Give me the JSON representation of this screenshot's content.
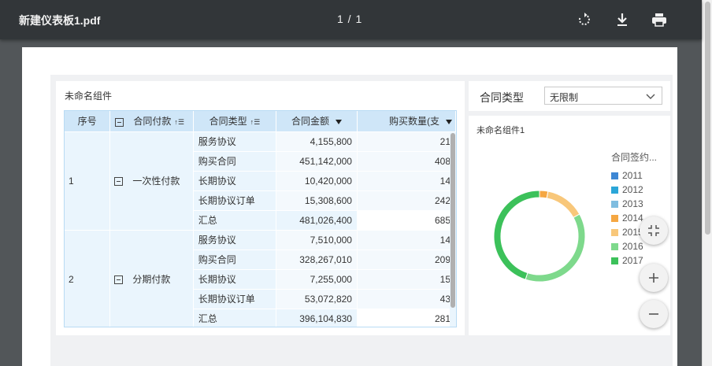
{
  "toolbar": {
    "title": "新建仪表板1.pdf",
    "page_indicator": "1 / 1",
    "icons": [
      "rotate-icon",
      "download-icon",
      "print-icon"
    ]
  },
  "table_widget": {
    "title": "未命名组件",
    "columns": [
      "序号",
      "合同付款",
      "合同类型",
      "合同金额",
      "购买数量(支"
    ],
    "groups": [
      {
        "seq": "1",
        "payment": "一次性付款",
        "rows": [
          {
            "type": "服务协议",
            "amount": "4,155,800",
            "qty": "21"
          },
          {
            "type": "购买合同",
            "amount": "451,142,000",
            "qty": "408"
          },
          {
            "type": "长期协议",
            "amount": "10,420,000",
            "qty": "14"
          },
          {
            "type": "长期协议订单",
            "amount": "15,308,600",
            "qty": "242"
          },
          {
            "type": "汇总",
            "amount": "481,026,400",
            "qty": "685"
          }
        ]
      },
      {
        "seq": "2",
        "payment": "分期付款",
        "rows": [
          {
            "type": "服务协议",
            "amount": "7,510,000",
            "qty": "14"
          },
          {
            "type": "购买合同",
            "amount": "328,267,010",
            "qty": "209"
          },
          {
            "type": "长期协议",
            "amount": "7,255,000",
            "qty": "15"
          },
          {
            "type": "长期协议订单",
            "amount": "53,072,820",
            "qty": "43"
          },
          {
            "type": "汇总",
            "amount": "396,104,830",
            "qty": "281"
          }
        ]
      }
    ]
  },
  "filter_widget": {
    "label": "合同类型",
    "selected": "无限制"
  },
  "chart_widget": {
    "title": "未命名组件1",
    "legend_title": "合同签约...",
    "zoom_buttons": [
      "fit-icon",
      "zoom-in-icon",
      "zoom-out-icon"
    ]
  },
  "chart_data": {
    "type": "pie",
    "legend": [
      "2011",
      "2012",
      "2013",
      "2014",
      "2015",
      "2016",
      "2017"
    ],
    "colors": [
      "#3d87d4",
      "#2ba6d8",
      "#7fbde0",
      "#f5a742",
      "#f8c77a",
      "#7ed98c",
      "#3cc15a"
    ],
    "values": [
      0,
      0,
      0,
      3,
      14,
      38,
      45
    ]
  }
}
